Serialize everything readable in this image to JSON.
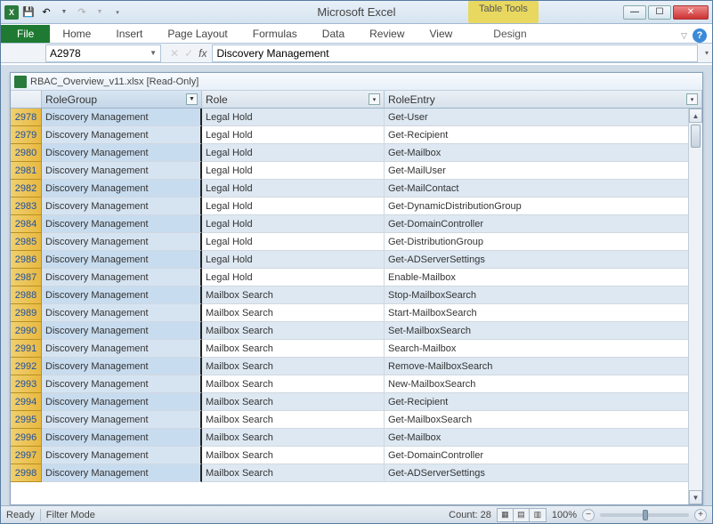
{
  "app": {
    "title": "Microsoft Excel",
    "table_tools": "Table Tools"
  },
  "qat": {
    "save": "💾",
    "undo": "↶",
    "redo": "↷"
  },
  "ribbon": {
    "file": "File",
    "tabs": [
      "Home",
      "Insert",
      "Page Layout",
      "Formulas",
      "Data",
      "Review",
      "View"
    ],
    "contextual": "Design",
    "min_icon": "▽",
    "help_icon": "?"
  },
  "formula_bar": {
    "name_box": "A2978",
    "fx": "fx",
    "value": "Discovery Management"
  },
  "workbook": {
    "title": "RBAC_Overview_v11.xlsx  [Read-Only]"
  },
  "columns": {
    "A": "RoleGroup",
    "B": "Role",
    "C": "RoleEntry"
  },
  "rows": [
    {
      "n": 2978,
      "a": "Discovery Management",
      "b": "Legal Hold",
      "c": "Get-User"
    },
    {
      "n": 2979,
      "a": "Discovery Management",
      "b": "Legal Hold",
      "c": "Get-Recipient"
    },
    {
      "n": 2980,
      "a": "Discovery Management",
      "b": "Legal Hold",
      "c": "Get-Mailbox"
    },
    {
      "n": 2981,
      "a": "Discovery Management",
      "b": "Legal Hold",
      "c": "Get-MailUser"
    },
    {
      "n": 2982,
      "a": "Discovery Management",
      "b": "Legal Hold",
      "c": "Get-MailContact"
    },
    {
      "n": 2983,
      "a": "Discovery Management",
      "b": "Legal Hold",
      "c": "Get-DynamicDistributionGroup"
    },
    {
      "n": 2984,
      "a": "Discovery Management",
      "b": "Legal Hold",
      "c": "Get-DomainController"
    },
    {
      "n": 2985,
      "a": "Discovery Management",
      "b": "Legal Hold",
      "c": "Get-DistributionGroup"
    },
    {
      "n": 2986,
      "a": "Discovery Management",
      "b": "Legal Hold",
      "c": "Get-ADServerSettings"
    },
    {
      "n": 2987,
      "a": "Discovery Management",
      "b": "Legal Hold",
      "c": "Enable-Mailbox"
    },
    {
      "n": 2988,
      "a": "Discovery Management",
      "b": "Mailbox Search",
      "c": "Stop-MailboxSearch"
    },
    {
      "n": 2989,
      "a": "Discovery Management",
      "b": "Mailbox Search",
      "c": "Start-MailboxSearch"
    },
    {
      "n": 2990,
      "a": "Discovery Management",
      "b": "Mailbox Search",
      "c": "Set-MailboxSearch"
    },
    {
      "n": 2991,
      "a": "Discovery Management",
      "b": "Mailbox Search",
      "c": "Search-Mailbox"
    },
    {
      "n": 2992,
      "a": "Discovery Management",
      "b": "Mailbox Search",
      "c": "Remove-MailboxSearch"
    },
    {
      "n": 2993,
      "a": "Discovery Management",
      "b": "Mailbox Search",
      "c": "New-MailboxSearch"
    },
    {
      "n": 2994,
      "a": "Discovery Management",
      "b": "Mailbox Search",
      "c": "Get-Recipient"
    },
    {
      "n": 2995,
      "a": "Discovery Management",
      "b": "Mailbox Search",
      "c": "Get-MailboxSearch"
    },
    {
      "n": 2996,
      "a": "Discovery Management",
      "b": "Mailbox Search",
      "c": "Get-Mailbox"
    },
    {
      "n": 2997,
      "a": "Discovery Management",
      "b": "Mailbox Search",
      "c": "Get-DomainController"
    },
    {
      "n": 2998,
      "a": "Discovery Management",
      "b": "Mailbox Search",
      "c": "Get-ADServerSettings"
    }
  ],
  "status": {
    "ready": "Ready",
    "filter_mode": "Filter Mode",
    "count": "Count: 28",
    "zoom": "100%"
  },
  "glyphs": {
    "filter_active": "▼",
    "filter_normal": "▾",
    "up": "▲",
    "down": "▼",
    "minus": "−",
    "plus": "+"
  }
}
